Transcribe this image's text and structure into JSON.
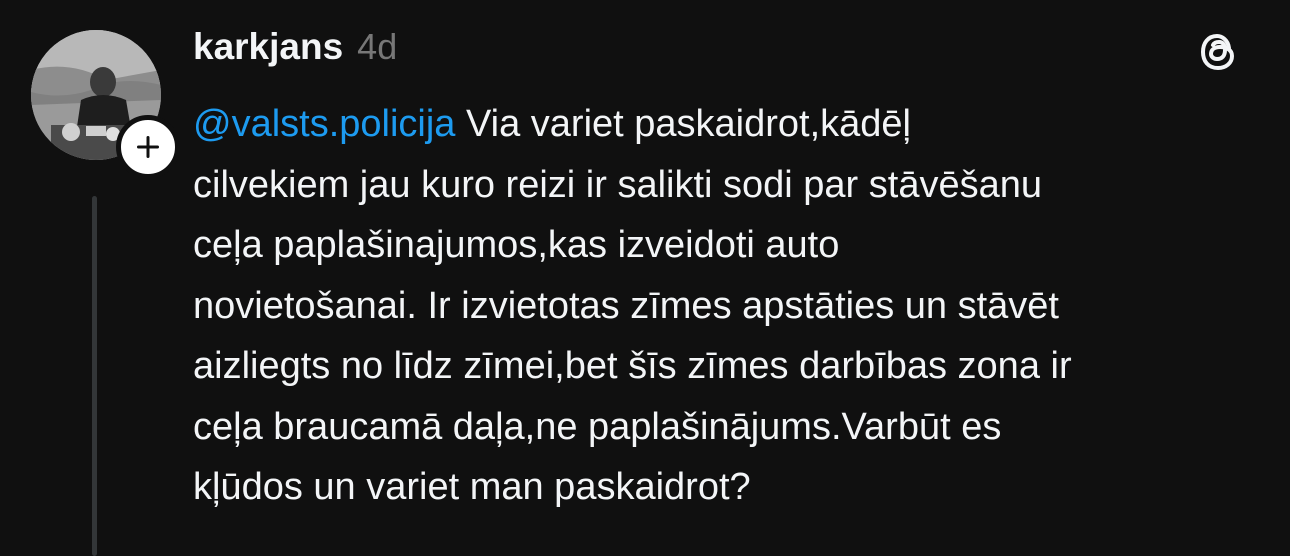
{
  "post": {
    "username": "karkjans",
    "timestamp": "4d",
    "mention": "@valsts.policija",
    "first_line_rest": " Via variet paskaidrot,kādēļ",
    "lines": [
      "cilvekiem jau kuro reizi ir salikti sodi par stāvēšanu",
      "ceļa paplašinajumos,kas izveidoti auto",
      "novietošanai. Ir izvietotas zīmes apstāties un stāvēt",
      "aizliegts no līdz zīmei,bet šīs zīmes darbības zona ir",
      "ceļa braucamā daļa,ne paplašinājums.Varbūt es",
      "kļūdos un variet man paskaidrot?"
    ]
  },
  "icons": {
    "avatar": "profile-photo",
    "follow": "plus-icon",
    "app_logo": "threads-logo-icon"
  },
  "colors": {
    "background": "#101010",
    "text": "#f3f5f7",
    "muted": "#777777",
    "mention": "#1d9bf0",
    "thread_line": "#333638"
  }
}
